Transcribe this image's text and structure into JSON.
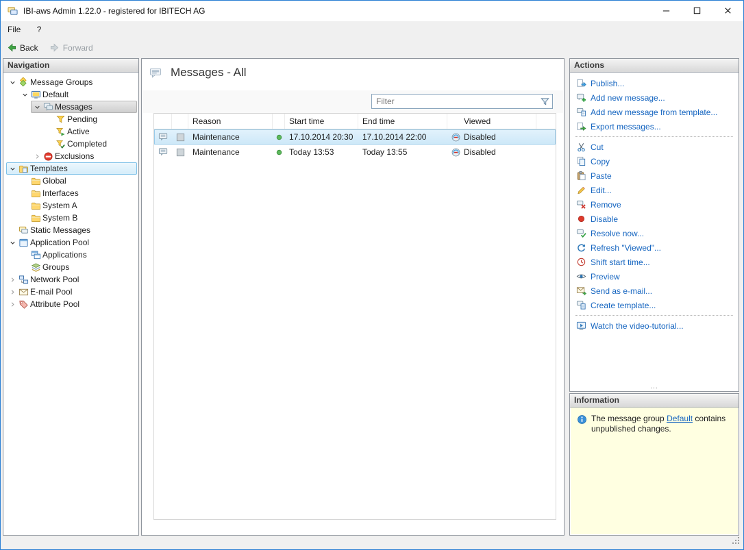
{
  "window": {
    "title": "IBI-aws Admin 1.22.0 - registered for IBITECH AG"
  },
  "menu": {
    "file": "File",
    "help": "?"
  },
  "toolbar": {
    "back": "Back",
    "forward": "Forward"
  },
  "colors": {
    "accent_link": "#1565c0",
    "selection_blue": "#cde8f8",
    "info_background": "#ffffe1",
    "window_border": "#2a7fd4",
    "status_green": "#5cb85c",
    "disable_red": "#dd3a2c"
  },
  "navigation": {
    "header": "Navigation",
    "items": [
      {
        "id": "message-groups",
        "label": "Message Groups",
        "level": 0,
        "arrow": "down",
        "icon": "msg-groups",
        "state": ""
      },
      {
        "id": "default",
        "label": "Default",
        "level": 1,
        "arrow": "down",
        "icon": "screen",
        "state": ""
      },
      {
        "id": "messages",
        "label": "Messages",
        "level": 2,
        "arrow": "down",
        "icon": "bubbles",
        "state": "selected"
      },
      {
        "id": "pending",
        "label": "Pending",
        "level": 3,
        "arrow": "none",
        "icon": "funnel-pending",
        "state": ""
      },
      {
        "id": "active",
        "label": "Active",
        "level": 3,
        "arrow": "none",
        "icon": "funnel-active",
        "state": ""
      },
      {
        "id": "completed",
        "label": "Completed",
        "level": 3,
        "arrow": "none",
        "icon": "funnel-done",
        "state": ""
      },
      {
        "id": "exclusions",
        "label": "Exclusions",
        "level": 2,
        "arrow": "right",
        "icon": "no-entry",
        "state": ""
      },
      {
        "id": "templates",
        "label": "Templates",
        "level": 0,
        "arrow": "down",
        "icon": "folder-template",
        "state": "hover"
      },
      {
        "id": "global",
        "label": "Global",
        "level": 1,
        "arrow": "none",
        "icon": "folder",
        "state": ""
      },
      {
        "id": "interfaces",
        "label": "Interfaces",
        "level": 1,
        "arrow": "none",
        "icon": "folder",
        "state": ""
      },
      {
        "id": "system-a",
        "label": "System A",
        "level": 1,
        "arrow": "none",
        "icon": "folder",
        "state": ""
      },
      {
        "id": "system-b",
        "label": "System B",
        "level": 1,
        "arrow": "none",
        "icon": "folder",
        "state": ""
      },
      {
        "id": "static-messages",
        "label": "Static Messages",
        "level": 0,
        "arrow": "none",
        "icon": "static-msg",
        "state": ""
      },
      {
        "id": "application-pool",
        "label": "Application Pool",
        "level": 0,
        "arrow": "down",
        "icon": "app-pool",
        "state": ""
      },
      {
        "id": "applications",
        "label": "Applications",
        "level": 1,
        "arrow": "none",
        "icon": "applications",
        "state": ""
      },
      {
        "id": "groups",
        "label": "Groups",
        "level": 1,
        "arrow": "none",
        "icon": "groups",
        "state": ""
      },
      {
        "id": "network-pool",
        "label": "Network Pool",
        "level": 0,
        "arrow": "right",
        "icon": "network",
        "state": ""
      },
      {
        "id": "email-pool",
        "label": "E-mail Pool",
        "level": 0,
        "arrow": "right",
        "icon": "email",
        "state": ""
      },
      {
        "id": "attribute-pool",
        "label": "Attribute Pool",
        "level": 0,
        "arrow": "right",
        "icon": "attribute",
        "state": ""
      }
    ]
  },
  "main": {
    "title": "Messages - All",
    "filter": {
      "placeholder": "Filter"
    },
    "table": {
      "columns": {
        "reason": "Reason",
        "start": "Start time",
        "end": "End time",
        "viewed": "Viewed"
      },
      "rows": [
        {
          "reason": "Maintenance",
          "start": "17.10.2014 20:30",
          "end": "17.10.2014 22:00",
          "viewed": "Disabled",
          "selected": true
        },
        {
          "reason": "Maintenance",
          "start": "Today 13:53",
          "end": "Today 13:55",
          "viewed": "Disabled",
          "selected": false
        }
      ]
    }
  },
  "actions": {
    "header": "Actions",
    "overflow": "...",
    "items": [
      {
        "id": "publish",
        "label": "Publish...",
        "icon": "publish"
      },
      {
        "id": "add-new-message",
        "label": "Add new message...",
        "icon": "add-message"
      },
      {
        "id": "add-new-message-from-template",
        "label": "Add new message from template...",
        "icon": "add-from-template"
      },
      {
        "id": "export-messages",
        "label": "Export messages...",
        "icon": "export"
      },
      {
        "separator": true
      },
      {
        "id": "cut",
        "label": "Cut",
        "icon": "cut"
      },
      {
        "id": "copy",
        "label": "Copy",
        "icon": "copy"
      },
      {
        "id": "paste",
        "label": "Paste",
        "icon": "paste"
      },
      {
        "id": "edit",
        "label": "Edit...",
        "icon": "edit"
      },
      {
        "id": "remove",
        "label": "Remove",
        "icon": "remove"
      },
      {
        "id": "disable",
        "label": "Disable",
        "icon": "disable"
      },
      {
        "id": "resolve-now",
        "label": "Resolve now...",
        "icon": "resolve"
      },
      {
        "id": "refresh-viewed",
        "label": "Refresh \"Viewed\"...",
        "icon": "refresh"
      },
      {
        "id": "shift-start-time",
        "label": "Shift start time...",
        "icon": "clock"
      },
      {
        "id": "preview",
        "label": "Preview",
        "icon": "eye"
      },
      {
        "id": "send-as-email",
        "label": "Send as e-mail...",
        "icon": "send-email"
      },
      {
        "id": "create-template",
        "label": "Create template...",
        "icon": "create-template"
      },
      {
        "separator": true
      },
      {
        "id": "watch-video-tutorial",
        "label": "Watch the video-tutorial...",
        "icon": "video"
      }
    ]
  },
  "information": {
    "header": "Information",
    "text_before": "The message group ",
    "link_label": "Default",
    "text_after": " contains unpublished changes."
  }
}
